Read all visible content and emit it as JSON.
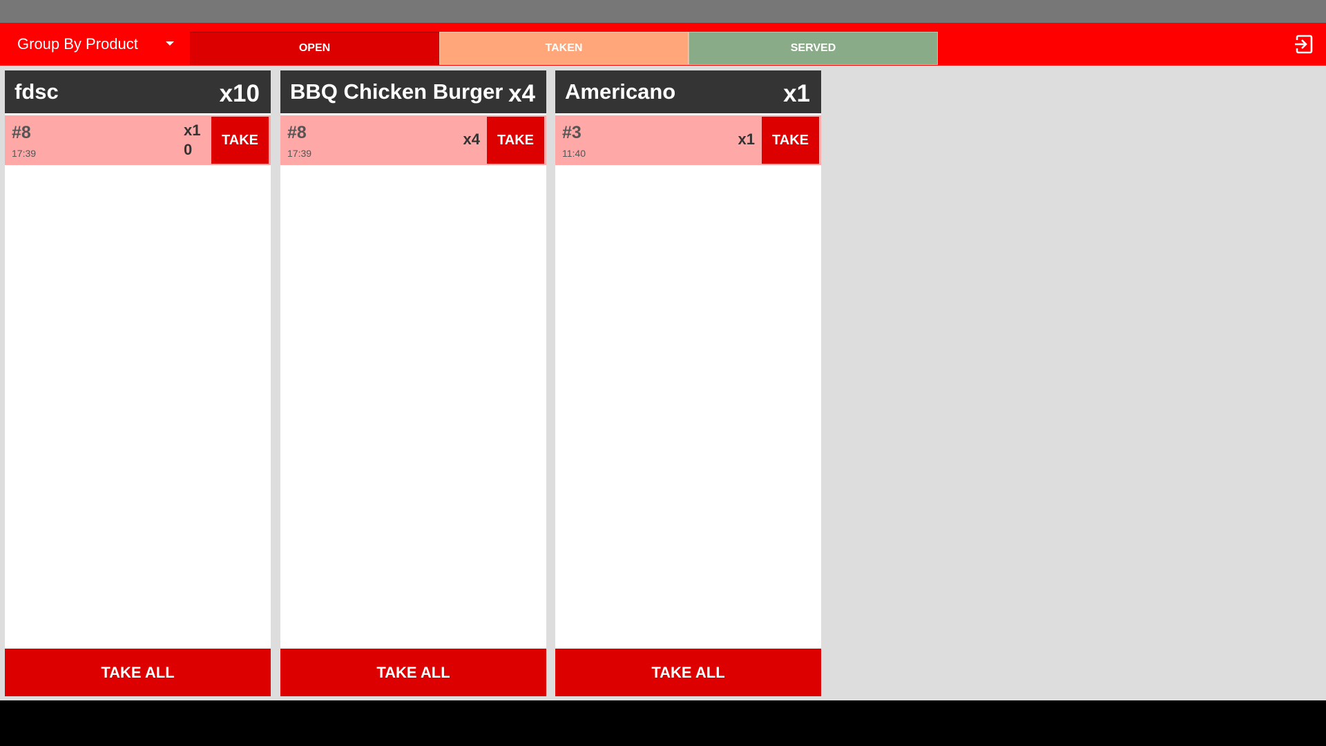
{
  "app_bar": {
    "group_select_label": "Group By Product",
    "tabs": [
      {
        "label": "OPEN",
        "active": true,
        "color": "#dd0000"
      },
      {
        "label": "TAKEN",
        "active": false,
        "color": "#ffa67a"
      },
      {
        "label": "SERVED",
        "active": false,
        "color": "#8aab87"
      }
    ],
    "logout_icon": "logout-icon",
    "background_color": "#ff0000"
  },
  "columns": [
    {
      "title": "fdsc",
      "count": "x10",
      "orders": [
        {
          "number": "#8",
          "time": "17:39",
          "qty": "x10",
          "take_label": "TAKE"
        }
      ],
      "take_all_label": "TAKE ALL"
    },
    {
      "title": "BBQ Chicken Burger",
      "count": "x4",
      "orders": [
        {
          "number": "#8",
          "time": "17:39",
          "qty": "x4",
          "take_label": "TAKE"
        }
      ],
      "take_all_label": "TAKE ALL"
    },
    {
      "title": "Americano",
      "count": "x1",
      "orders": [
        {
          "number": "#3",
          "time": "11:40",
          "qty": "x1",
          "take_label": "TAKE"
        }
      ],
      "take_all_label": "TAKE ALL"
    }
  ]
}
